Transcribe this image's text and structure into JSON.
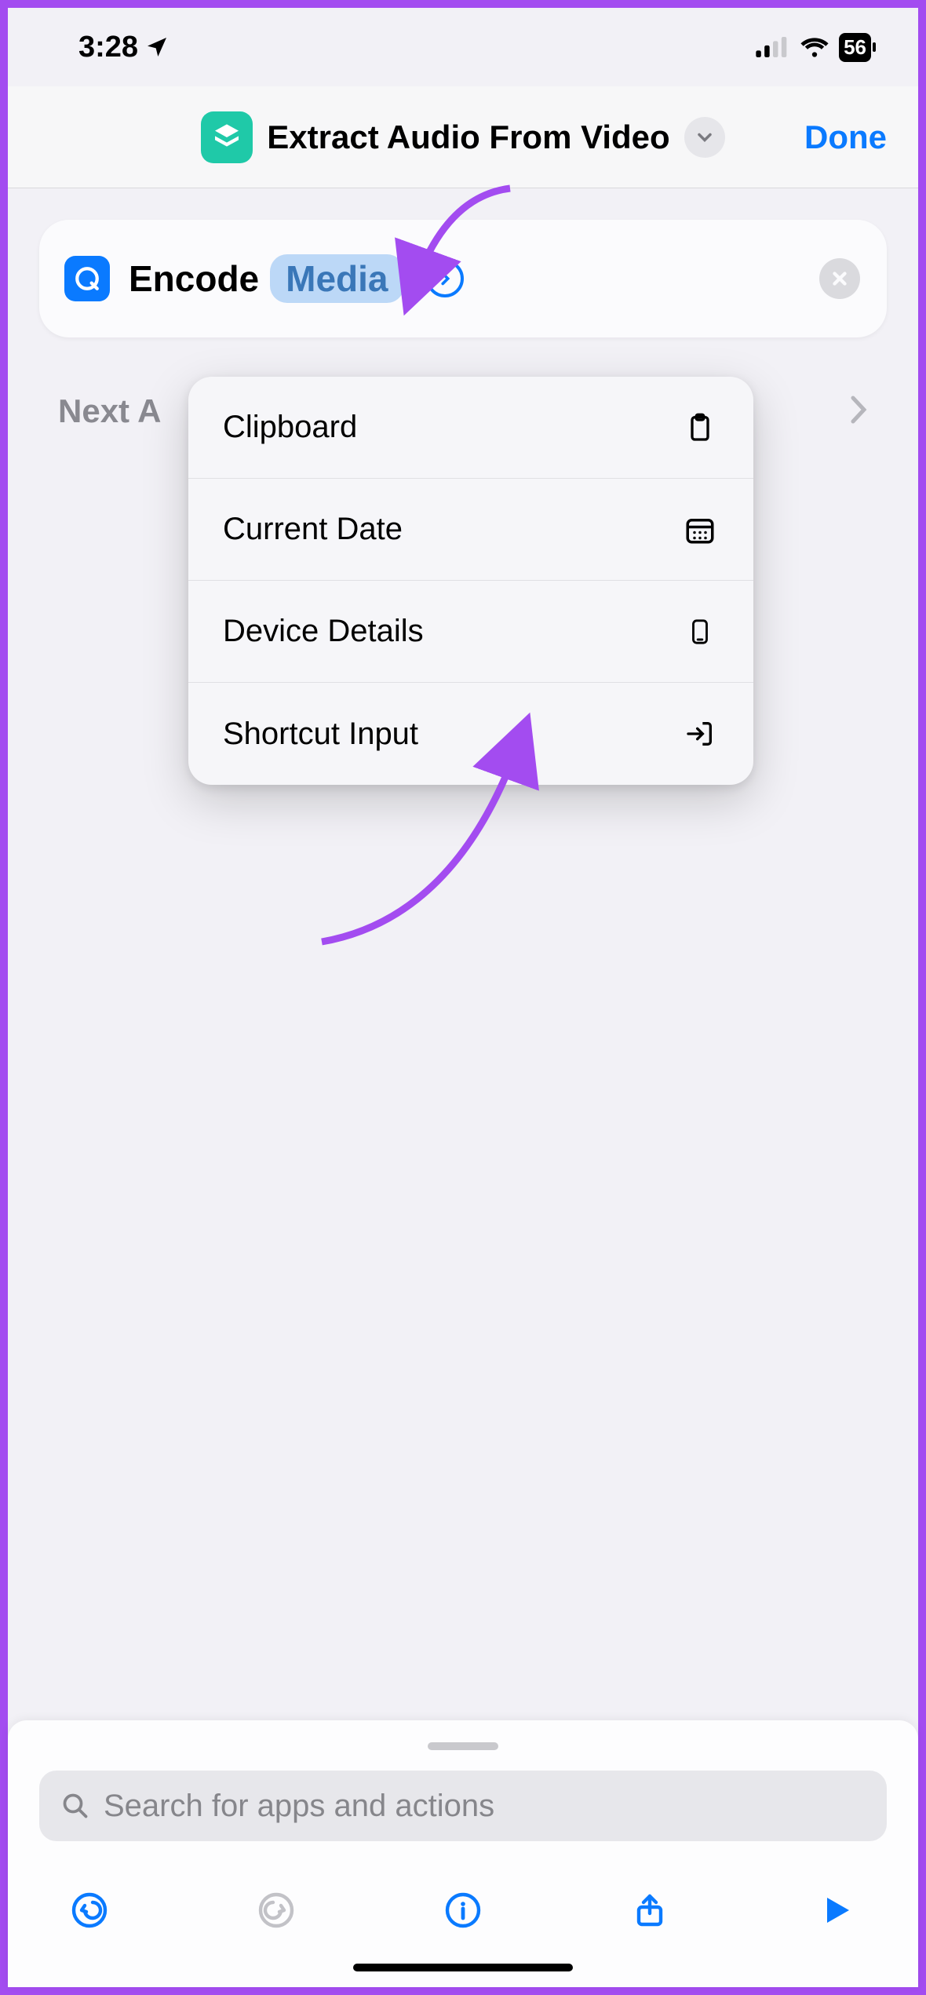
{
  "status": {
    "time": "3:28",
    "battery": "56"
  },
  "nav": {
    "title": "Extract Audio From Video",
    "done": "Done"
  },
  "action": {
    "verb": "Encode",
    "param": "Media"
  },
  "next_label": "Next A",
  "popup": {
    "items": [
      {
        "label": "Clipboard",
        "icon": "clipboard"
      },
      {
        "label": "Current Date",
        "icon": "calendar"
      },
      {
        "label": "Device Details",
        "icon": "phone"
      },
      {
        "label": "Shortcut Input",
        "icon": "input"
      }
    ]
  },
  "search": {
    "placeholder": "Search for apps and actions"
  }
}
